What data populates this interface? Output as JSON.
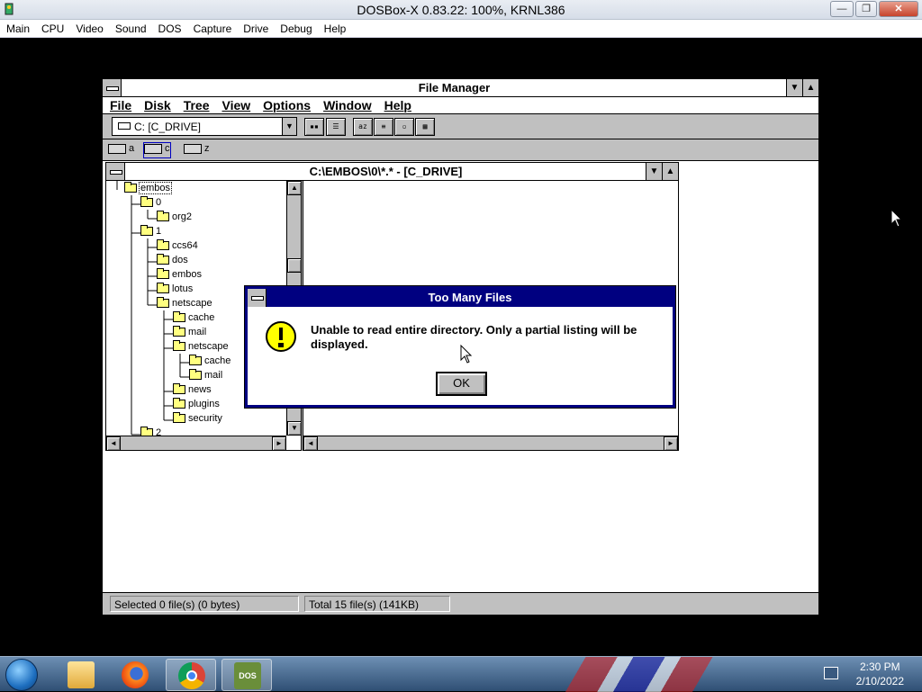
{
  "host": {
    "title": "DOSBox-X 0.83.22: 100%, KRNL386",
    "menu": [
      "Main",
      "CPU",
      "Video",
      "Sound",
      "DOS",
      "Capture",
      "Drive",
      "Debug",
      "Help"
    ],
    "min": "—",
    "max": "❐",
    "close": "✕"
  },
  "file_manager": {
    "title": "File Manager",
    "menu": [
      "File",
      "Disk",
      "Tree",
      "View",
      "Options",
      "Window",
      "Help"
    ],
    "drive_combo": "C: [C_DRIVE]",
    "drives": [
      "a",
      "c",
      "z"
    ],
    "child_title": "C:\\EMBOS\\0\\*.* - [C_DRIVE]",
    "tree": [
      {
        "label": "embos",
        "level": 0
      },
      {
        "label": "0",
        "level": 1
      },
      {
        "label": "org2",
        "level": 2
      },
      {
        "label": "1",
        "level": 1
      },
      {
        "label": "ccs64",
        "level": 2
      },
      {
        "label": "dos",
        "level": 2
      },
      {
        "label": "embos",
        "level": 2
      },
      {
        "label": "lotus",
        "level": 2
      },
      {
        "label": "netscape",
        "level": 2
      },
      {
        "label": "cache",
        "level": 3
      },
      {
        "label": "mail",
        "level": 3
      },
      {
        "label": "netscape",
        "level": 3
      },
      {
        "label": "cache",
        "level": 4
      },
      {
        "label": "mail",
        "level": 4
      },
      {
        "label": "news",
        "level": 3
      },
      {
        "label": "plugins",
        "level": 3
      },
      {
        "label": "security",
        "level": 3
      },
      {
        "label": "2",
        "level": 1
      }
    ],
    "status_selected": "Selected 0 file(s) (0 bytes)",
    "status_total": "Total 15 file(s) (141KB)"
  },
  "dialog": {
    "title": "Too Many Files",
    "message": "Unable to read entire directory. Only a partial listing will be displayed.",
    "ok": "OK"
  },
  "taskbar": {
    "time": "2:30 PM",
    "date": "2/10/2022",
    "apps": [
      "windows-explorer",
      "firefox",
      "chrome",
      "dosbox"
    ],
    "dosbox_label": "DOS"
  }
}
